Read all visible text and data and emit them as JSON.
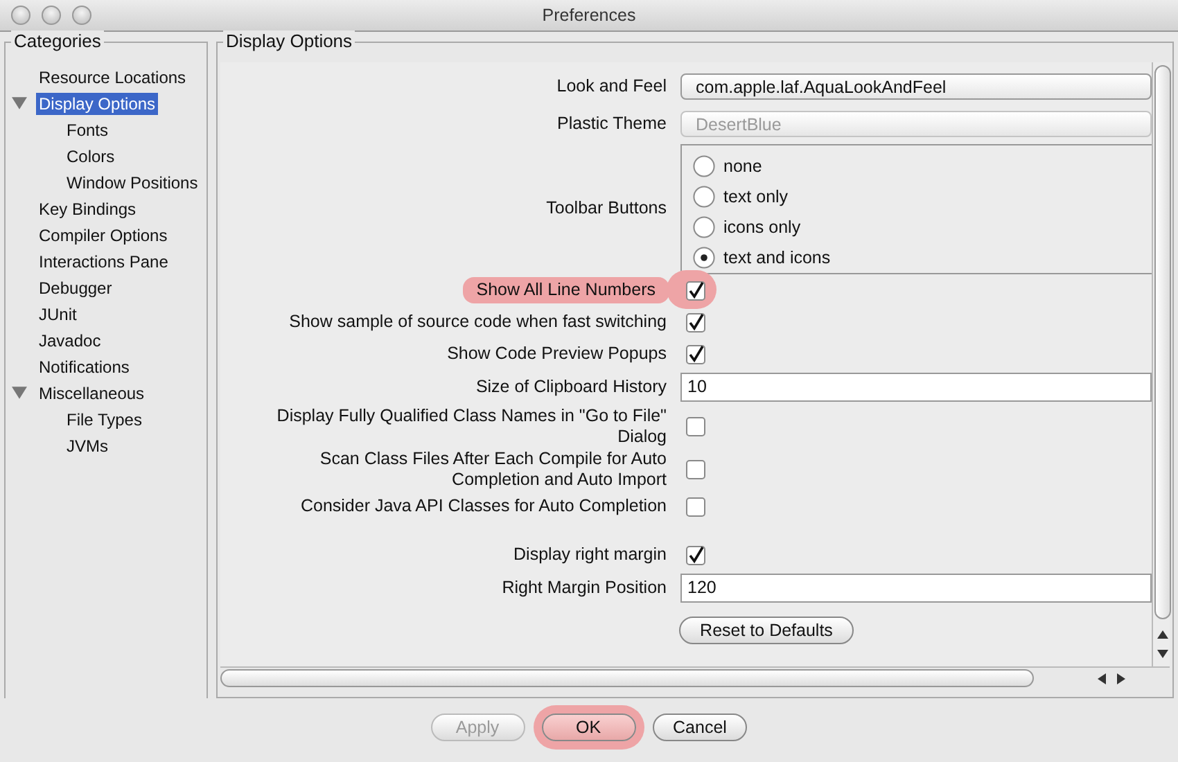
{
  "window": {
    "title": "Preferences"
  },
  "categories": {
    "title": "Categories",
    "items": [
      {
        "label": "Resource Locations",
        "selected": false
      },
      {
        "label": "Display Options",
        "selected": true,
        "expanded": true,
        "children": [
          {
            "label": "Fonts",
            "selected": false
          },
          {
            "label": "Colors",
            "selected": false
          },
          {
            "label": "Window Positions",
            "selected": false
          }
        ]
      },
      {
        "label": "Key Bindings",
        "selected": false
      },
      {
        "label": "Compiler Options",
        "selected": false
      },
      {
        "label": "Interactions Pane",
        "selected": false
      },
      {
        "label": "Debugger",
        "selected": false
      },
      {
        "label": "JUnit",
        "selected": false
      },
      {
        "label": "Javadoc",
        "selected": false
      },
      {
        "label": "Notifications",
        "selected": false
      },
      {
        "label": "Miscellaneous",
        "selected": false,
        "expanded": true,
        "children": [
          {
            "label": "File Types",
            "selected": false
          },
          {
            "label": "JVMs",
            "selected": false
          }
        ]
      }
    ]
  },
  "panel": {
    "title": "Display Options",
    "options": [
      {
        "kind": "combo",
        "label": "Look and Feel",
        "value": "com.apple.laf.AquaLookAndFeel",
        "disabled": false
      },
      {
        "kind": "combo",
        "label": "Plastic Theme",
        "value": "DesertBlue",
        "disabled": true
      },
      {
        "kind": "radio",
        "label": "Toolbar Buttons",
        "choices": [
          {
            "label": "none",
            "selected": false
          },
          {
            "label": "text only",
            "selected": false
          },
          {
            "label": "icons only",
            "selected": false
          },
          {
            "label": "text and icons",
            "selected": true
          }
        ]
      },
      {
        "kind": "checkbox",
        "label": "Show All Line Numbers",
        "checked": true,
        "highlighted": true
      },
      {
        "kind": "checkbox",
        "label": "Show sample of source code when fast switching",
        "checked": true,
        "highlighted": false
      },
      {
        "kind": "checkbox",
        "label": "Show Code Preview Popups",
        "checked": true,
        "highlighted": false
      },
      {
        "kind": "text",
        "label": "Size of Clipboard History",
        "value": "10"
      },
      {
        "kind": "checkbox",
        "label": "Display Fully Qualified Class Names in \"Go to File\" Dialog",
        "checked": false,
        "highlighted": false
      },
      {
        "kind": "checkbox",
        "label": "Scan Class Files After Each Compile for Auto Completion and Auto Import",
        "checked": false,
        "highlighted": false
      },
      {
        "kind": "checkbox",
        "label": "Consider Java API Classes for Auto Completion",
        "checked": false,
        "highlighted": false
      },
      {
        "kind": "checkbox",
        "label": "Display right margin",
        "checked": true,
        "highlighted": false
      },
      {
        "kind": "text",
        "label": "Right Margin Position",
        "value": "120"
      }
    ],
    "reset_button": "Reset to Defaults"
  },
  "buttons": [
    {
      "label": "Apply",
      "disabled": true,
      "highlighted": false
    },
    {
      "label": "OK",
      "disabled": false,
      "highlighted": true
    },
    {
      "label": "Cancel",
      "disabled": false,
      "highlighted": false
    }
  ]
}
